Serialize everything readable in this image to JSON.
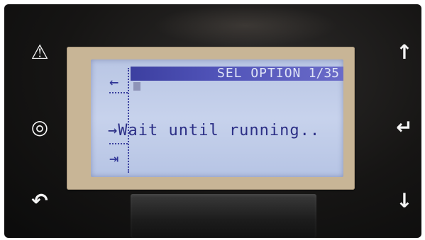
{
  "display": {
    "title": "SEL OPTION",
    "page_counter": "1/35",
    "message": "→Wait until running..",
    "left_nav": {
      "back_arrow": "←",
      "exit_glyph": "⇥"
    }
  },
  "buttons": {
    "alarm": "⚠",
    "program": "◎",
    "escape": "↶",
    "up": "↑",
    "enter": "↵",
    "down": "↓"
  },
  "colors": {
    "lcd_background": "#c3cfea",
    "lcd_text": "#2c2f86",
    "title_bar": "#4a4db0",
    "bezel": "#c8b596",
    "panel": "#161514"
  }
}
